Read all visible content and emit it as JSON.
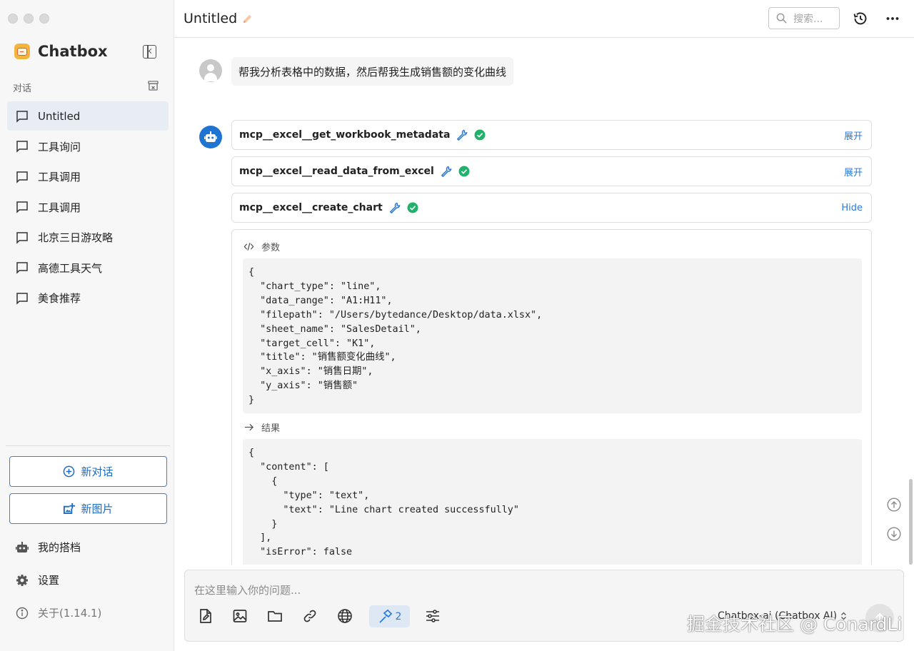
{
  "app": {
    "name": "Chatbox",
    "conversation_title": "Untitled",
    "version_label": "关于(1.14.1)"
  },
  "sidebar": {
    "section_label": "对话",
    "conversations": [
      {
        "label": "Untitled",
        "active": true
      },
      {
        "label": "工具询问",
        "active": false
      },
      {
        "label": "工具调用",
        "active": false
      },
      {
        "label": "工具调用",
        "active": false
      },
      {
        "label": "北京三日游攻略",
        "active": false
      },
      {
        "label": "高德工具天气",
        "active": false
      },
      {
        "label": "美食推荐",
        "active": false
      }
    ],
    "new_chat_label": "新对话",
    "new_image_label": "新图片",
    "my_copilots_label": "我的搭档",
    "settings_label": "设置"
  },
  "header": {
    "search_placeholder": "搜索..."
  },
  "messages": {
    "user_text": "帮我分析表格中的数据，然后帮我生成销售额的变化曲线",
    "tool_calls": [
      {
        "name": "mcp__excel__get_workbook_metadata",
        "toggle": "展开"
      },
      {
        "name": "mcp__excel__read_data_from_excel",
        "toggle": "展开"
      },
      {
        "name": "mcp__excel__create_chart",
        "toggle": "Hide"
      }
    ],
    "params_label": "参数",
    "params_code": "{\n  \"chart_type\": \"line\",\n  \"data_range\": \"A1:H11\",\n  \"filepath\": \"/Users/bytedance/Desktop/data.xlsx\",\n  \"sheet_name\": \"SalesDetail\",\n  \"target_cell\": \"K1\",\n  \"title\": \"销售额变化曲线\",\n  \"x_axis\": \"销售日期\",\n  \"y_axis\": \"销售额\"\n}",
    "result_label": "结果",
    "result_code": "{\n  \"content\": [\n    {\n      \"type\": \"text\",\n      \"text\": \"Line chart created successfully\"\n    }\n  ],\n  \"isError\": false"
  },
  "composer": {
    "placeholder": "在这里输入你的问题...",
    "mcp_count": "2",
    "model_label": "Chatbox-ai (Chatbox AI)"
  },
  "watermark": "掘金技术社区 @ ConardLi",
  "colors": {
    "accent": "#2a7ad9",
    "success": "#20b26b",
    "active_item": "#e8edf4"
  }
}
